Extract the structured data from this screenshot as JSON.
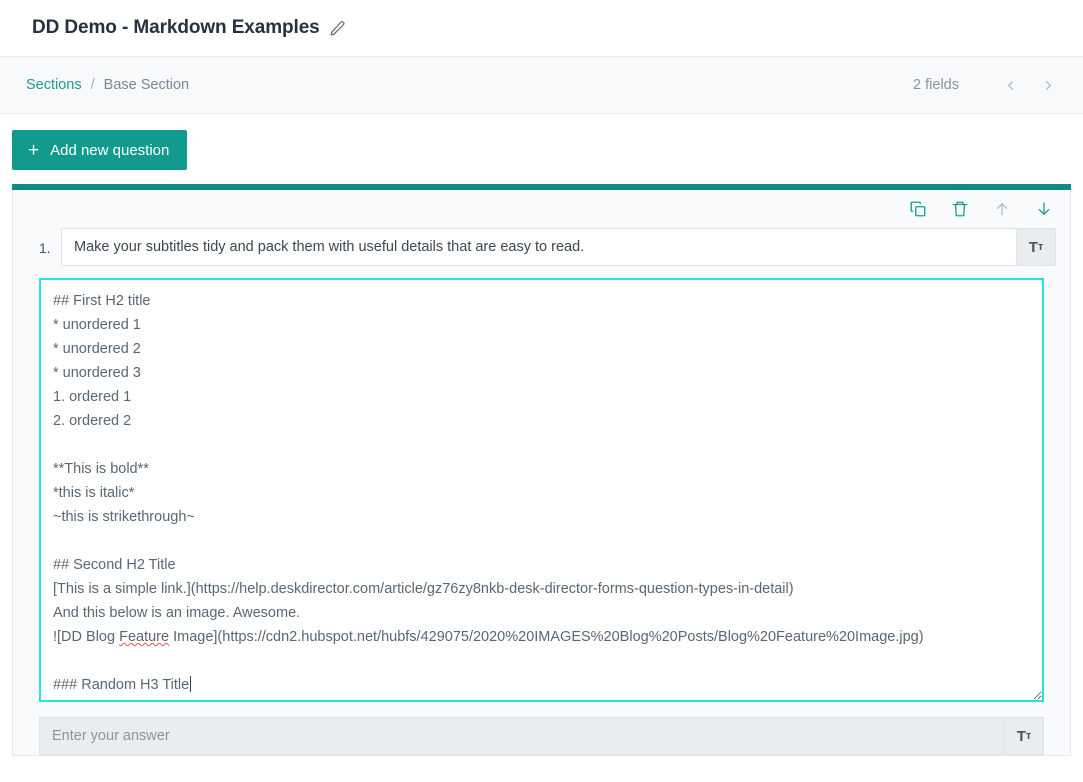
{
  "header": {
    "form_title": "DD Demo - Markdown Examples",
    "edit_icon": "pencil-icon"
  },
  "breadcrumb": {
    "root_label": "Sections",
    "separator": "/",
    "current_label": "Base Section",
    "field_count": "2 fields",
    "prev_icon": "chevron-left-icon",
    "next_icon": "chevron-right-icon"
  },
  "toolbar": {
    "add_question_label": "Add new question",
    "add_icon": "plus-icon"
  },
  "question_card": {
    "actions": [
      {
        "name": "duplicate-icon",
        "label": "Duplicate"
      },
      {
        "name": "delete-icon",
        "label": "Delete"
      },
      {
        "name": "move-up-icon",
        "label": "Move up"
      },
      {
        "name": "move-down-icon",
        "label": "Move down"
      }
    ],
    "number": "1.",
    "title_value": "Make your subtitles tidy and pack them with useful details that are easy to read.",
    "title_format_button": "Tт",
    "markdown_lines": [
      "## First H2 title",
      "* unordered 1",
      "* unordered 2",
      "* unordered 3",
      "1. ordered 1",
      "2. ordered 2",
      "",
      "**This is bold**",
      "*this is italic*",
      "~this is strikethrough~",
      "",
      "## Second H2 Title",
      "[This is a simple link.](https://help.deskdirector.com/article/gz76zy8nkb-desk-director-forms-question-types-in-detail)",
      "And this below is an image. Awesome.",
      "![DD Blog Feature Image](https://cdn2.hubspot.net/hubfs/429075/2020%20IMAGES%20Blog%20Posts/Blog%20Feature%20Image.jpg)",
      "",
      "### Random H3 Title"
    ],
    "answer_placeholder": "Enter your answer",
    "answer_format_button": "Tт"
  },
  "colors": {
    "accent_teal": "#119a8d",
    "card_accent": "#0e8b82",
    "link_teal": "#1b9c93",
    "focus_cyan": "#26e3e3",
    "disabled_gray": "#b6bfc8"
  }
}
